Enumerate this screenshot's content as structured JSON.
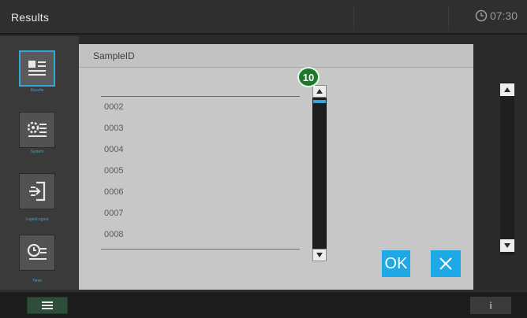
{
  "window": {
    "title": "Results",
    "clock": "07:30"
  },
  "sidebar": {
    "items": [
      {
        "label": "Results",
        "icon": "results-list-icon",
        "active": true
      },
      {
        "label": "System",
        "icon": "system-settings-icon",
        "active": false
      },
      {
        "label": "Login/Logout",
        "icon": "login-logout-icon",
        "active": false
      },
      {
        "label": "Timer",
        "icon": "timer-list-icon",
        "active": false
      }
    ]
  },
  "dialog": {
    "title": "SampleID",
    "list": [
      "0002",
      "0003",
      "0004",
      "0005",
      "0006",
      "0007",
      "0008"
    ],
    "badge": "10",
    "scrollbar": {
      "position_fraction": 0.0
    },
    "ok_label": "OK",
    "cancel_icon": "close-icon"
  },
  "bottom": {
    "menu_icon": "menu-icon",
    "info_label": "i"
  },
  "colors": {
    "accent": "#1fa8e6",
    "highlight": "#33a8d6",
    "badge": "#1a7a2a",
    "dialog_bg": "#c7c7c7",
    "titlebar": "#2f2f2f"
  }
}
